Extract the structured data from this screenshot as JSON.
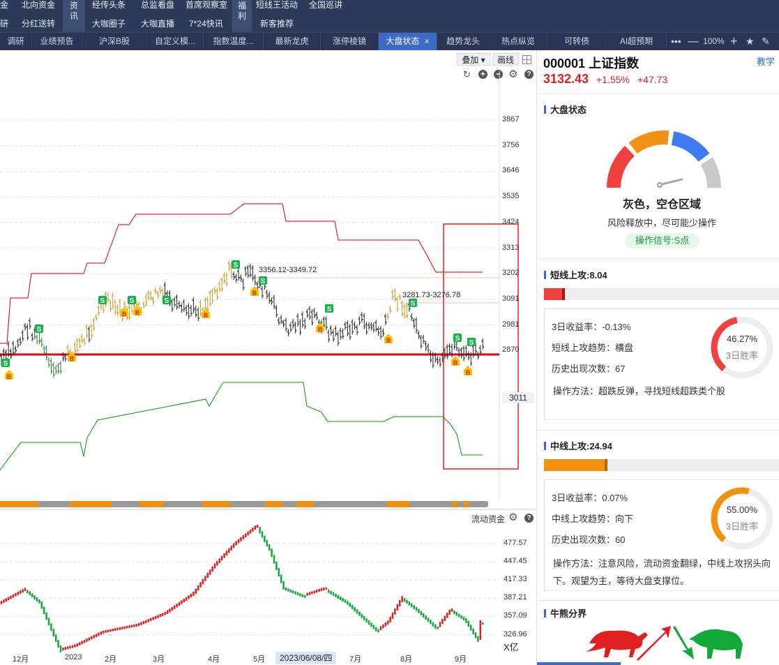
{
  "top_nav": {
    "row1": [
      "金",
      "北向资金",
      "经传头条",
      "总监看盘",
      "首席观察室",
      "短线王活动",
      "全国巡讲"
    ],
    "row2": [
      "研",
      "分红送转",
      "大咖圈子",
      "大咖直播",
      "7*24快讯",
      "新客推荐"
    ],
    "active_a": [
      "资",
      "讯"
    ],
    "active_b": [
      "福",
      "利"
    ]
  },
  "tabs": [
    "调研",
    "业绩预告",
    "沪深B股",
    "自定义模...",
    "指数温度...",
    "最新龙虎",
    "涨停棱镜",
    "大盘状态",
    "趋势龙头",
    "热点纵览",
    "可转债",
    "AI超预期"
  ],
  "tab_close": "×",
  "zoom": "100%",
  "toolbar": {
    "overlay": "叠加 ▾",
    "draw": "画线"
  },
  "chart": {
    "y_ticks": [
      "3867",
      "3756",
      "3646",
      "3535",
      "3424",
      "3313",
      "3202",
      "3091",
      "2981",
      "2870"
    ],
    "current_price_tag": "3011",
    "annotation1": "3356.12-3349.72",
    "annotation2": "3281.73-3276.78",
    "signal_s": "S",
    "signal_b": "B"
  },
  "sub_chart": {
    "title": "流动资金",
    "y_ticks": [
      "477.57",
      "447.45",
      "417.33",
      "387.21",
      "357.09",
      "326.96"
    ],
    "unit": "X亿"
  },
  "x_axis": [
    "12月",
    "2023",
    "2月",
    "3月",
    "4月",
    "5月",
    "7月",
    "8月",
    "9月"
  ],
  "x_cursor_label": "2023/06/08/四",
  "right": {
    "title": "000001 上证指数",
    "help_link": "教学",
    "price": "3132.43",
    "change_pct": "+1.55%",
    "change": "+47.73",
    "market_state": {
      "title": "大盘状态",
      "status": "灰色，空仓区域",
      "desc": "风险释放中，尽可能少操作",
      "signal": "操作信号:S点",
      "gauge_colors": [
        "#f04040",
        "#f39012",
        "#3e7bf0",
        "#c9c9c9"
      ]
    },
    "short": {
      "title": "短线上攻:8.04",
      "bar_fraction": 0.09,
      "ret_label": "3日收益率：",
      "ret_value": "-0.13%",
      "trend_label": "短线上攻趋势：",
      "trend_value": "横盘",
      "count_label": "历史出现次数：",
      "count_value": "67",
      "method": "操作方法：超跌反弹，寻找短线超跌类个股",
      "win_pct": "46.27%",
      "win_label": "3日胜率",
      "win_fraction": 0.4627,
      "color": "#f04040"
    },
    "mid": {
      "title": "中线上攻:24.94",
      "bar_fraction": 0.27,
      "ret_label": "3日收益率：",
      "ret_value": "0.07%",
      "trend_label": "中线上攻趋势：",
      "trend_value": "向下",
      "count_label": "历史出现次数：",
      "count_value": "60",
      "method": "操作方法：注意风险，流动资金翻绿，中线上攻拐头向下。观望为主，等待大盘支撑位。",
      "win_pct": "55.00%",
      "win_label": "3日胜率",
      "win_fraction": 0.55,
      "color": "#f39012"
    },
    "bull_bear": {
      "title": "牛熊分界"
    }
  }
}
